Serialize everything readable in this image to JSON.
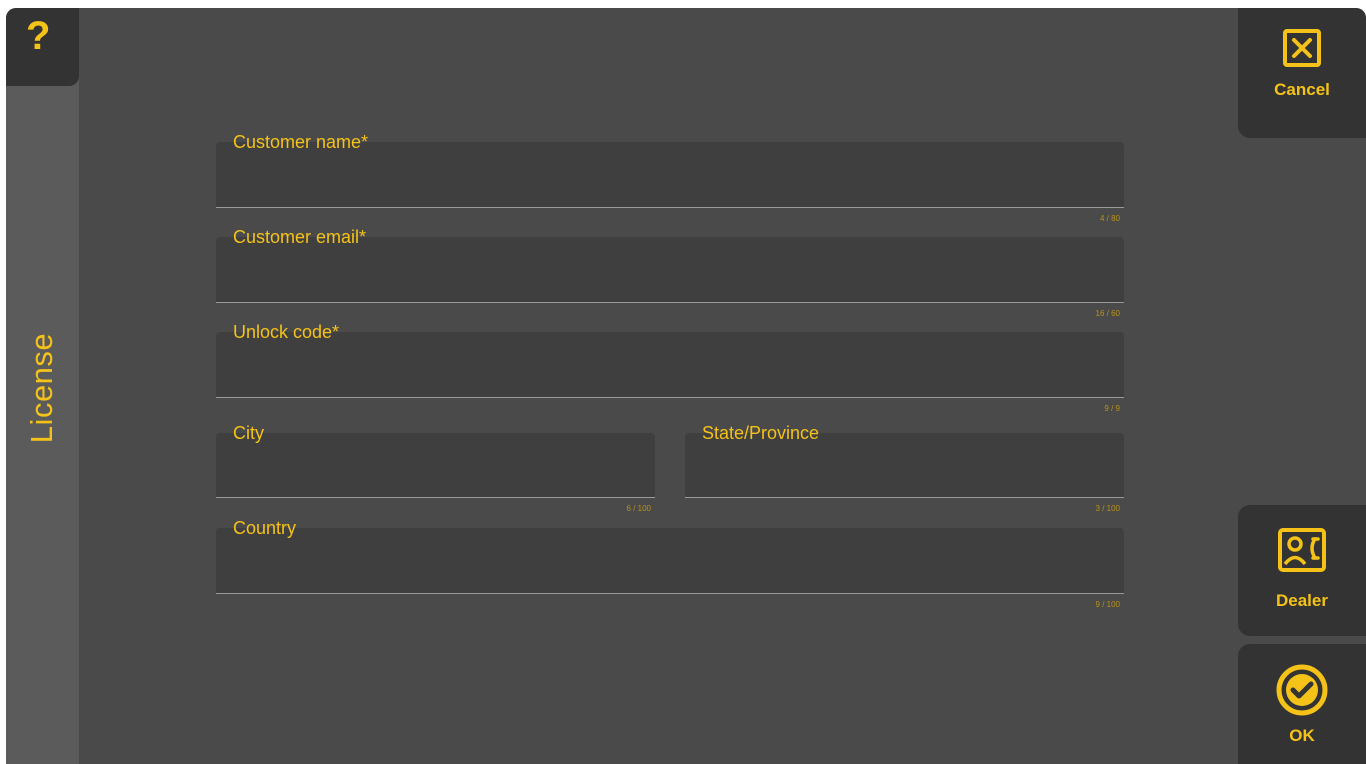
{
  "sidebar": {
    "help_glyph": "?",
    "title": "License"
  },
  "actions": {
    "cancel": {
      "label": "Cancel",
      "icon": "close-box-icon"
    },
    "dealer": {
      "label": "Dealer",
      "icon": "contact-card-icon"
    },
    "ok": {
      "label": "OK",
      "icon": "check-circle-icon"
    }
  },
  "form": {
    "customer_name": {
      "label": "Customer name*",
      "value": "",
      "counter": "4 / 80"
    },
    "customer_email": {
      "label": "Customer email*",
      "value": "",
      "counter": "16 / 60"
    },
    "unlock_code": {
      "label": "Unlock code*",
      "value": "",
      "counter": "9 / 9"
    },
    "city": {
      "label": "City",
      "value": "",
      "counter": "6 / 100"
    },
    "state": {
      "label": "State/Province",
      "value": "",
      "counter": "3 / 100"
    },
    "country": {
      "label": "Country",
      "value": "",
      "counter": "9 / 100"
    }
  },
  "colors": {
    "accent": "#f5c218",
    "panel": "#4a4a4a",
    "rail": "#5b5b5b",
    "button": "#333333"
  }
}
